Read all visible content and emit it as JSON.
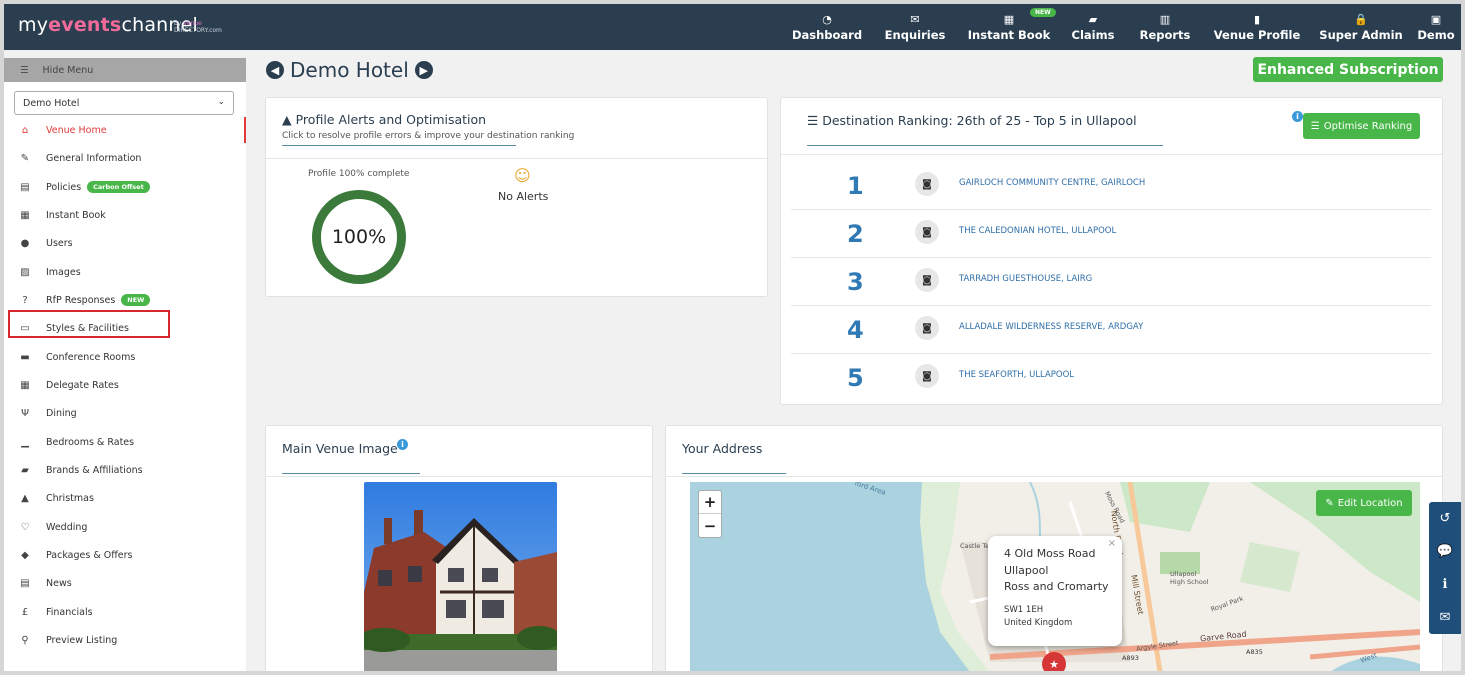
{
  "brand": {
    "logo_my": "my",
    "logo_events": "events",
    "logo_channel": "channel",
    "logo_by": "by",
    "logo_venue": "venue",
    "logo_directory": "DIRECTORY.com"
  },
  "nav": [
    {
      "label": "Dashboard",
      "icon": "tachometer-icon",
      "glyph": "◔"
    },
    {
      "label": "Enquiries",
      "icon": "envelope-icon",
      "glyph": "✉"
    },
    {
      "label": "Instant Book",
      "icon": "calendar-icon",
      "glyph": "▦",
      "badge": "NEW"
    },
    {
      "label": "Claims",
      "icon": "book-icon",
      "glyph": "▰"
    },
    {
      "label": "Reports",
      "icon": "bar-chart-icon",
      "glyph": "▥"
    },
    {
      "label": "Venue Profile",
      "icon": "building-icon",
      "glyph": "▮"
    },
    {
      "label": "Super Admin",
      "icon": "lock-icon",
      "glyph": "🔒"
    },
    {
      "label": "Demo",
      "icon": "user-box-icon",
      "glyph": "▣"
    }
  ],
  "sidebar": {
    "hide_label": "Hide Menu",
    "venue_select": "Demo Hotel",
    "items": [
      {
        "label": "Venue Home",
        "icon": "home-icon",
        "glyph": "⌂",
        "active": true
      },
      {
        "label": "General Information",
        "icon": "edit-icon",
        "glyph": "✎"
      },
      {
        "label": "Policies",
        "icon": "file-icon",
        "glyph": "▤",
        "pill": "Carbon Offset"
      },
      {
        "label": "Instant Book",
        "icon": "calendar-icon",
        "glyph": "▦"
      },
      {
        "label": "Users",
        "icon": "user-icon",
        "glyph": "●"
      },
      {
        "label": "Images",
        "icon": "image-icon",
        "glyph": "▨"
      },
      {
        "label": "RfP Responses",
        "icon": "question-icon",
        "glyph": "?",
        "pill": "NEW"
      },
      {
        "label": "Styles & Facilities",
        "icon": "monitor-icon",
        "glyph": "▭"
      },
      {
        "label": "Conference Rooms",
        "icon": "briefcase-icon",
        "glyph": "▬"
      },
      {
        "label": "Delegate Rates",
        "icon": "calculator-icon",
        "glyph": "▦"
      },
      {
        "label": "Dining",
        "icon": "cutlery-icon",
        "glyph": "Ψ"
      },
      {
        "label": "Bedrooms & Rates",
        "icon": "bed-icon",
        "glyph": "▁"
      },
      {
        "label": "Brands & Affiliations",
        "icon": "book-icon",
        "glyph": "▰"
      },
      {
        "label": "Christmas",
        "icon": "tree-icon",
        "glyph": "▲"
      },
      {
        "label": "Wedding",
        "icon": "heart-icon",
        "glyph": "♡"
      },
      {
        "label": "Packages & Offers",
        "icon": "tags-icon",
        "glyph": "◆"
      },
      {
        "label": "News",
        "icon": "newspaper-icon",
        "glyph": "▤"
      },
      {
        "label": "Financials",
        "icon": "pound-icon",
        "glyph": "£"
      },
      {
        "label": "Preview Listing",
        "icon": "search-icon",
        "glyph": "⚲"
      }
    ]
  },
  "header": {
    "title": "Demo Hotel",
    "subscription": "Enhanced Subscription"
  },
  "alerts": {
    "title": "Profile Alerts and Optimisation",
    "subtitle": "Click to resolve profile errors & improve your destination ranking",
    "complete_label": "Profile 100% complete",
    "percent": "100%",
    "progress": 1.0,
    "no_alerts": "No Alerts"
  },
  "ranking": {
    "title": "Destination Ranking: 26th of 25 - Top 5 in Ullapool",
    "optimise_label": "Optimise Ranking",
    "rows": [
      {
        "rank": "1",
        "name": "GAIRLOCH COMMUNITY CENTRE, GAIRLOCH"
      },
      {
        "rank": "2",
        "name": "THE CALEDONIAN HOTEL, ULLAPOOL"
      },
      {
        "rank": "3",
        "name": "TARRADH GUESTHOUSE, LAIRG"
      },
      {
        "rank": "4",
        "name": "ALLADALE WILDERNESS RESERVE, ARDGAY"
      },
      {
        "rank": "5",
        "name": "THE SEAFORTH, ULLAPOOL"
      }
    ]
  },
  "venue_image": {
    "title": "Main Venue Image"
  },
  "address": {
    "title": "Your Address",
    "edit_label": "Edit Location",
    "line1": "4 Old Moss Road",
    "line2": "Ullapool",
    "line3": "Ross and Cromarty",
    "postcode": "SW1 1EH",
    "country": "United Kingdom",
    "map_labels": {
      "north_road": "North Road",
      "mill_street": "Mill Street",
      "garve_road": "Garve Road",
      "school": "Ullapool High School",
      "a893": "A893",
      "a835": "A835",
      "royal_park": "Royal Park",
      "argyle": "Argyle Street",
      "castle": "Castle Terrace",
      "ford": "ford Area",
      "moss": "Moss Road",
      "west": "West"
    }
  },
  "colors": {
    "nav_bg": "#2b3e50",
    "accent_green": "#49b649",
    "link_blue": "#2f6fa8",
    "active_red": "#e03a3a"
  }
}
